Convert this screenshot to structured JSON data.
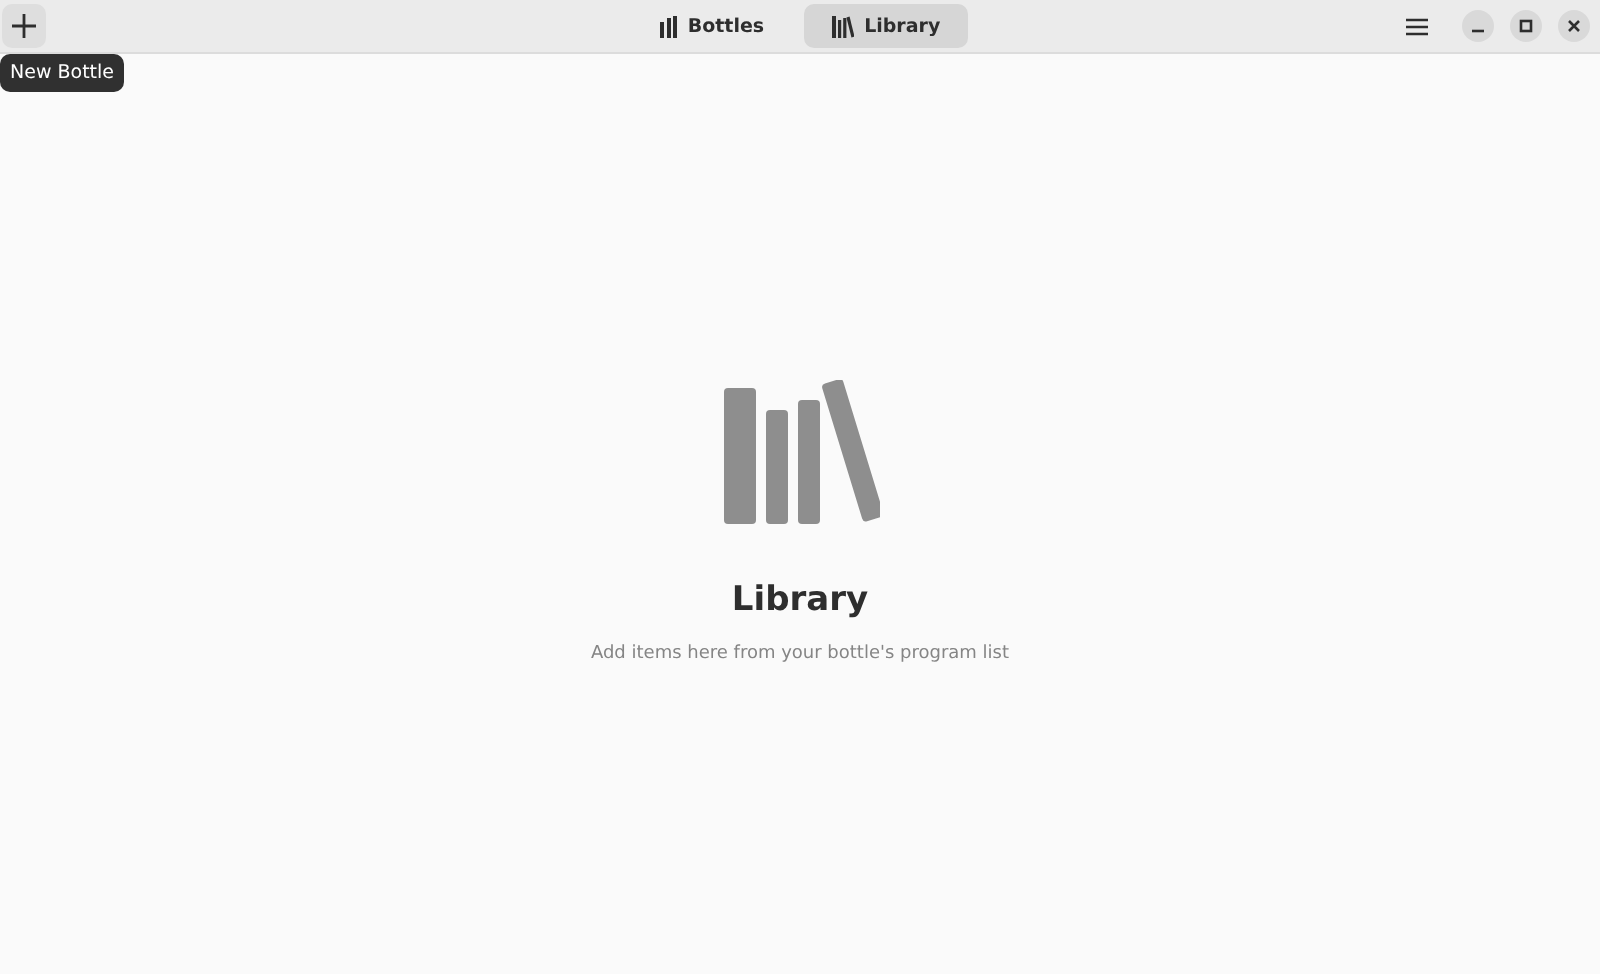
{
  "header": {
    "add_button": {
      "tooltip": "New Bottle"
    },
    "tabs": [
      {
        "label": "Bottles",
        "kind": "bottles",
        "selected": false
      },
      {
        "label": "Library",
        "kind": "library",
        "selected": true
      }
    ]
  },
  "status": {
    "title": "Library",
    "description": "Add items here from your bottle's program list"
  }
}
